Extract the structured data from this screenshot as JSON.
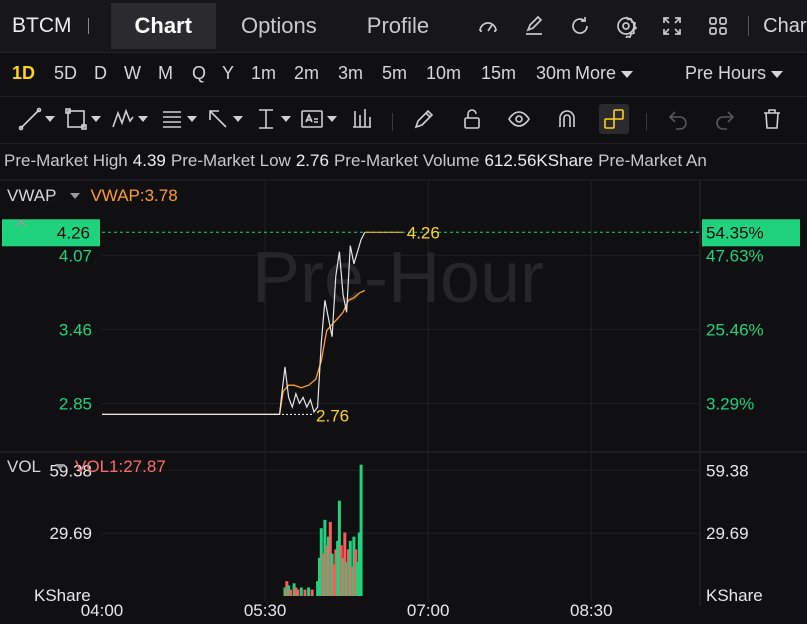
{
  "nav": {
    "ticker": "BTCM",
    "tabs": [
      {
        "label": "Chart",
        "active": true
      },
      {
        "label": "Options",
        "active": false
      },
      {
        "label": "Profile",
        "active": false
      }
    ],
    "icons": [
      "gauge-icon",
      "edit-icon",
      "refresh-icon",
      "gear-icon",
      "fullscreen-icon",
      "grid-icon"
    ],
    "more_label": "Char"
  },
  "periods": {
    "items": [
      "1D",
      "5D",
      "D",
      "W",
      "M",
      "Q",
      "Y",
      "1m",
      "2m",
      "3m",
      "5m",
      "10m",
      "15m",
      "30m"
    ],
    "active": "1D",
    "more_label": "More",
    "session_label": "Pre Hours"
  },
  "toolbar": {
    "tools": [
      "trend-line-icon",
      "rectangle-icon",
      "pattern-icon",
      "fibonacci-icon",
      "arrow-icon",
      "measure-icon",
      "text-icon",
      "bars-icon",
      "pencil-icon",
      "unlock-icon",
      "eye-icon",
      "magnet-icon",
      "link-icon",
      "undo-icon",
      "redo-icon",
      "trash-icon"
    ]
  },
  "stats": {
    "high_label": "Pre-Market High",
    "high_value": "4.39",
    "low_label": "Pre-Market Low",
    "low_value": "2.76",
    "volume_label": "Pre-Market Volume",
    "volume_value": "612.56KShare",
    "extra_label": "Pre-Market An"
  },
  "indicators": {
    "price": {
      "name": "VWAP",
      "value": "VWAP:3.78"
    },
    "volume": {
      "name": "VOL",
      "value": "VOL1:27.87"
    }
  },
  "colors": {
    "up": "#1fd27e",
    "down": "#ff5a5a",
    "vwap": "#ff9d2e",
    "highlight": "#ffd21e",
    "price_line": "#e6e6e8"
  },
  "chart_data": {
    "type": "line",
    "watermark": "Pre-Hour",
    "x_ticks": [
      "04:00",
      "05:30",
      "07:00",
      "08:30"
    ],
    "x_range_minutes": [
      240,
      570
    ],
    "price_axis": {
      "left_ticks": [
        "4.07",
        "3.46",
        "2.85"
      ],
      "right_ticks": [
        "47.63%",
        "25.46%",
        "3.29%"
      ],
      "current_price": "4.26",
      "current_pct": "54.35%",
      "ylim": [
        2.45,
        4.6
      ],
      "high_marker": "4.26",
      "low_marker": "2.76"
    },
    "volume_axis": {
      "left_ticks": [
        "59.38",
        "29.69"
      ],
      "right_ticks": [
        "59.38",
        "29.69"
      ],
      "unit": "KShare",
      "ylim": [
        0,
        68
      ]
    },
    "price_series": {
      "name": "Price",
      "x": [
        240,
        338,
        339,
        341,
        343,
        345,
        347,
        349,
        351,
        353,
        355,
        357,
        359,
        361,
        363,
        365,
        367,
        369,
        371,
        373,
        375,
        377,
        379,
        381,
        383,
        385
      ],
      "y": [
        2.76,
        2.76,
        2.9,
        3.15,
        2.9,
        2.82,
        2.93,
        2.85,
        2.9,
        2.82,
        2.88,
        2.78,
        2.82,
        3.35,
        3.7,
        3.55,
        3.4,
        3.9,
        4.1,
        3.75,
        3.6,
        4.15,
        4.0,
        4.1,
        4.2,
        4.26
      ]
    },
    "vwap_series": {
      "name": "VWAP",
      "x": [
        240,
        338,
        340,
        343,
        346,
        350,
        354,
        358,
        361,
        364,
        367,
        370,
        373,
        376,
        379,
        382,
        385
      ],
      "y": [
        2.76,
        2.76,
        2.95,
        3.0,
        3.0,
        2.98,
        3.0,
        3.05,
        3.2,
        3.45,
        3.5,
        3.55,
        3.6,
        3.7,
        3.72,
        3.76,
        3.78
      ]
    },
    "volume_series": {
      "name": "VOL",
      "x": [
        341,
        342,
        343,
        344,
        346,
        347,
        348,
        350,
        352,
        354,
        356,
        359,
        360,
        361,
        362,
        363,
        364,
        365,
        366,
        367,
        368,
        369,
        370,
        371,
        372,
        373,
        374,
        375,
        376,
        377,
        378,
        379,
        380,
        381,
        382,
        383
      ],
      "v": [
        4,
        7,
        5,
        3,
        6,
        4,
        3,
        4,
        3,
        4,
        3,
        7,
        18,
        32,
        20,
        36,
        24,
        28,
        35,
        20,
        15,
        22,
        26,
        45,
        24,
        18,
        30,
        16,
        22,
        26,
        14,
        28,
        22,
        16,
        30,
        62
      ],
      "up": [
        true,
        false,
        true,
        false,
        true,
        false,
        false,
        true,
        false,
        true,
        false,
        true,
        true,
        true,
        false,
        true,
        false,
        true,
        false,
        true,
        false,
        false,
        true,
        true,
        false,
        true,
        false,
        true,
        false,
        true,
        false,
        true,
        false,
        true,
        true,
        true
      ]
    }
  }
}
